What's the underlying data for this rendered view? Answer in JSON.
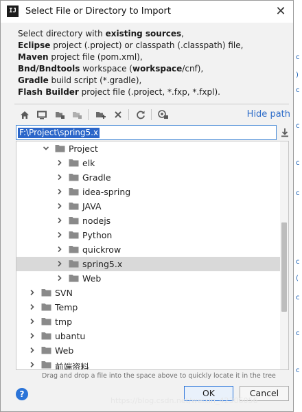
{
  "window": {
    "title": "Select File or Directory to Import",
    "app_icon_text": "IJ"
  },
  "description": {
    "line1_prefix": "Select directory with ",
    "line1_bold": "existing sources",
    "line1_suffix": ",",
    "line2_bold": "Eclipse",
    "line2_rest": " project (.project) or classpath (.classpath) file,",
    "line3_bold": "Maven",
    "line3_rest": " project file (pom.xml),",
    "line4_bold": "Bnd/Bndtools",
    "line4_rest": " workspace (",
    "line4_bold2": "workspace",
    "line4_rest2": "/cnf),",
    "line5_bold": "Gradle",
    "line5_rest": " build script (*.gradle),",
    "line6_bold": "Flash Builder",
    "line6_rest": " project file (.project, *.fxp, *.fxpl)."
  },
  "toolbar": {
    "icons": [
      "home-icon",
      "desktop-icon",
      "project-folder-icon",
      "module-folder-icon",
      "new-folder-icon",
      "delete-icon",
      "refresh-icon",
      "show-hidden-icon"
    ],
    "hide_path_label": "Hide path"
  },
  "path": {
    "value": "F:\\Project\\spring5.x"
  },
  "tree": {
    "items": [
      {
        "label": "Project",
        "level": 1,
        "expanded": true,
        "selected": false
      },
      {
        "label": "elk",
        "level": 2,
        "expanded": false,
        "selected": false
      },
      {
        "label": "Gradle",
        "level": 2,
        "expanded": false,
        "selected": false
      },
      {
        "label": "idea-spring",
        "level": 2,
        "expanded": false,
        "selected": false
      },
      {
        "label": "JAVA",
        "level": 2,
        "expanded": false,
        "selected": false
      },
      {
        "label": "nodejs",
        "level": 2,
        "expanded": false,
        "selected": false
      },
      {
        "label": "Python",
        "level": 2,
        "expanded": false,
        "selected": false
      },
      {
        "label": "quickrow",
        "level": 2,
        "expanded": false,
        "selected": false
      },
      {
        "label": "spring5.x",
        "level": 2,
        "expanded": false,
        "selected": true
      },
      {
        "label": "Web",
        "level": 2,
        "expanded": false,
        "selected": false
      },
      {
        "label": "SVN",
        "level": 0,
        "expanded": false,
        "selected": false
      },
      {
        "label": "Temp",
        "level": 0,
        "expanded": false,
        "selected": false
      },
      {
        "label": "tmp",
        "level": 0,
        "expanded": false,
        "selected": false
      },
      {
        "label": "ubantu",
        "level": 0,
        "expanded": false,
        "selected": false
      },
      {
        "label": "Web",
        "level": 0,
        "expanded": false,
        "selected": false
      },
      {
        "label": "前端资料",
        "level": 0,
        "expanded": false,
        "selected": false
      }
    ]
  },
  "hint": "Drag and drop a file into the space above to quickly locate it in the tree",
  "footer": {
    "help_label": "?",
    "ok_label": "OK",
    "cancel_label": "Cancel"
  },
  "watermark": "https://blog.csdn.net/weixin_42306056",
  "colors": {
    "accent": "#2b74d8",
    "selection": "#2b66c9",
    "row_selected": "#d9d9d9",
    "link": "#2d6cc9"
  }
}
